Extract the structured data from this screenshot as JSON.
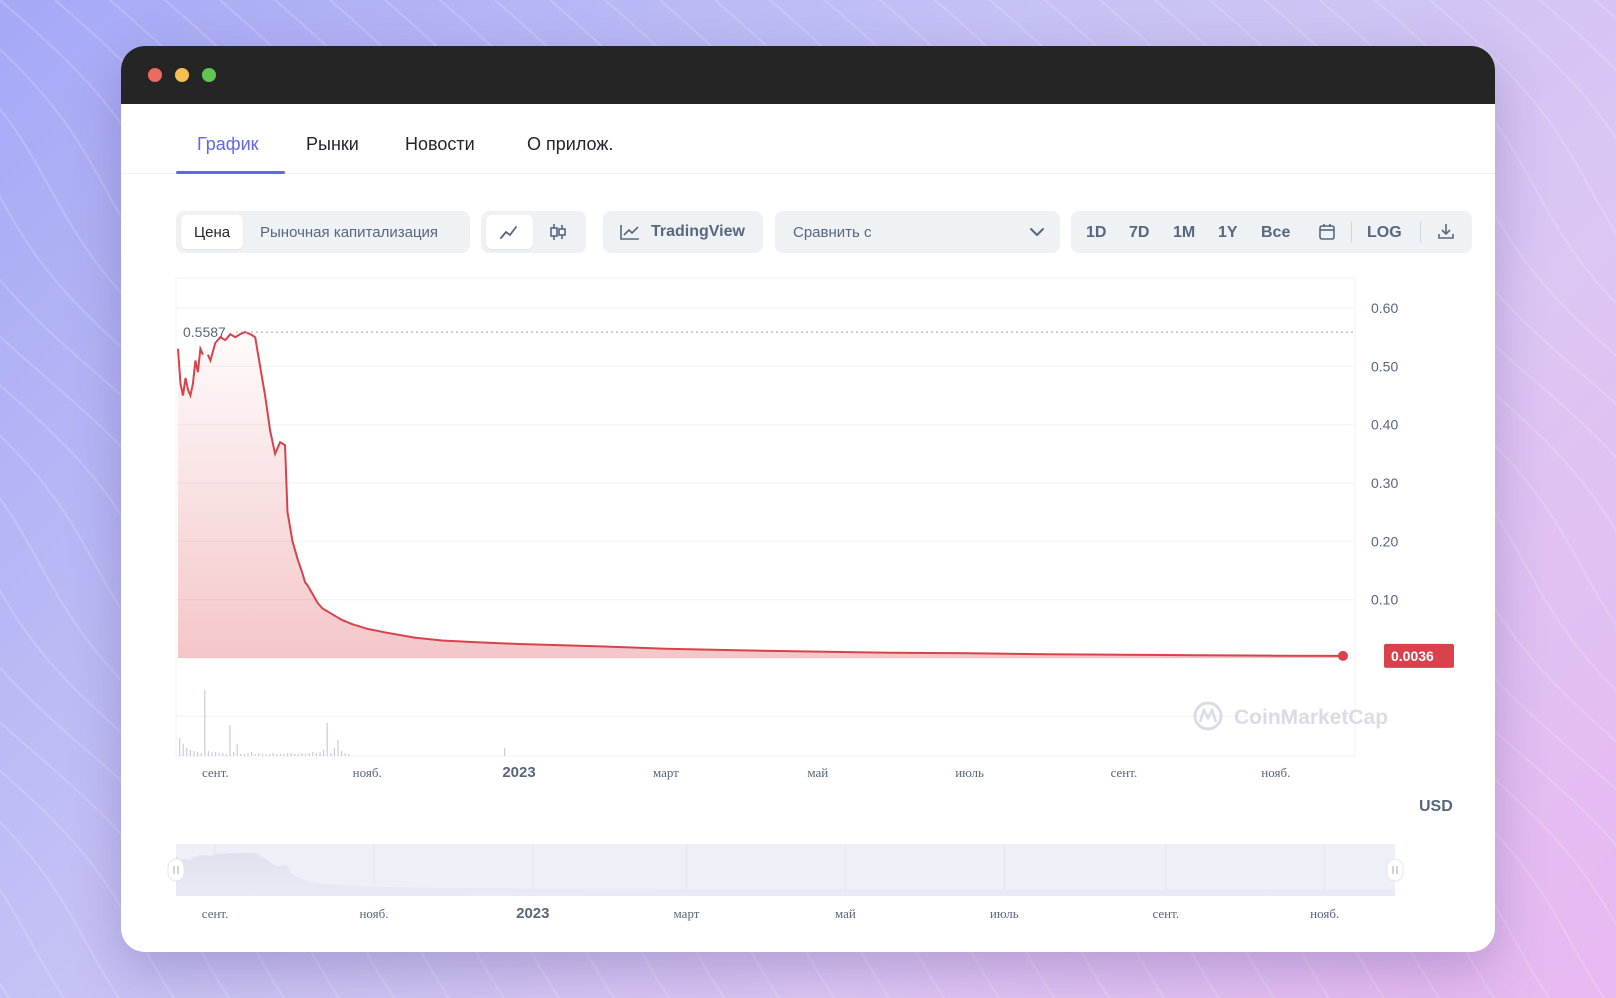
{
  "tabs": [
    {
      "label": "График",
      "active": true
    },
    {
      "label": "Рынки",
      "active": false
    },
    {
      "label": "Новости",
      "active": false
    },
    {
      "label": "О прилож.",
      "active": false
    }
  ],
  "toolbar": {
    "price_label": "Цена",
    "market_cap_label": "Рыночная капитализация",
    "tradingview_label": "TradingView",
    "compare_label": "Сравнить с",
    "ranges": [
      "1D",
      "7D",
      "1M",
      "1Y",
      "Все"
    ],
    "log_label": "LOG"
  },
  "watermark": "CoinMarketCap",
  "currency_label": "USD",
  "colors": {
    "accent": "#6167e8",
    "line": "#d9424a",
    "current_badge": "#d9424a"
  },
  "chart_data": {
    "type": "area",
    "y_ticks": [
      "0.60",
      "0.50",
      "0.40",
      "0.30",
      "0.20",
      "0.10"
    ],
    "ylim": [
      0,
      0.65
    ],
    "x_tick_labels": [
      "сент.",
      "нояб.",
      "2023",
      "март",
      "май",
      "июль",
      "сент.",
      "нояб."
    ],
    "max_label": "0.5587",
    "max_value": 0.5587,
    "current_label": "0.0036",
    "current_value": 0.0036,
    "grid": true,
    "series": [
      {
        "x": [
          "2022-08-17",
          "2022-08-18",
          "2022-08-19",
          "2022-08-20",
          "2022-08-21",
          "2022-08-22",
          "2022-08-23",
          "2022-08-24",
          "2022-08-25",
          "2022-08-26",
          "2022-08-27",
          "2022-08-29",
          "2022-08-30",
          "2022-09-01",
          "2022-09-03",
          "2022-09-05",
          "2022-09-07",
          "2022-09-09",
          "2022-09-11",
          "2022-09-13",
          "2022-09-15",
          "2022-09-17",
          "2022-09-19",
          "2022-09-21",
          "2022-09-23",
          "2022-09-25",
          "2022-09-27",
          "2022-09-29",
          "2022-09-30",
          "2022-10-02",
          "2022-10-04",
          "2022-10-06",
          "2022-10-07",
          "2022-10-08",
          "2022-10-10",
          "2022-10-12",
          "2022-10-14",
          "2022-10-18",
          "2022-10-22",
          "2022-10-26",
          "2022-11-01",
          "2022-11-08",
          "2022-11-20",
          "2022-12-01",
          "2022-12-15",
          "2023-01-01",
          "2023-02-01",
          "2023-03-01",
          "2023-04-01",
          "2023-05-01",
          "2023-06-01",
          "2023-07-01",
          "2023-08-01",
          "2023-09-01",
          "2023-10-01",
          "2023-11-01",
          "2023-11-28"
        ],
        "y": [
          0.53,
          0.47,
          0.45,
          0.48,
          0.46,
          0.45,
          0.47,
          0.51,
          0.49,
          0.53,
          0.52,
          0.52,
          0.51,
          0.54,
          0.55,
          0.545,
          0.555,
          0.55,
          0.555,
          0.5587,
          0.555,
          0.55,
          0.5,
          0.45,
          0.39,
          0.35,
          0.37,
          0.365,
          0.25,
          0.2,
          0.17,
          0.145,
          0.13,
          0.125,
          0.11,
          0.095,
          0.085,
          0.075,
          0.065,
          0.058,
          0.05,
          0.044,
          0.035,
          0.03,
          0.027,
          0.024,
          0.02,
          0.016,
          0.013,
          0.011,
          0.009,
          0.008,
          0.0065,
          0.0055,
          0.0047,
          0.004,
          0.0036
        ]
      }
    ],
    "gap": [
      "2022-08-27",
      "2022-08-29"
    ]
  },
  "navigator": {
    "x_tick_labels": [
      "сент.",
      "нояб.",
      "2023",
      "март",
      "май",
      "июль",
      "сент.",
      "нояб."
    ]
  }
}
